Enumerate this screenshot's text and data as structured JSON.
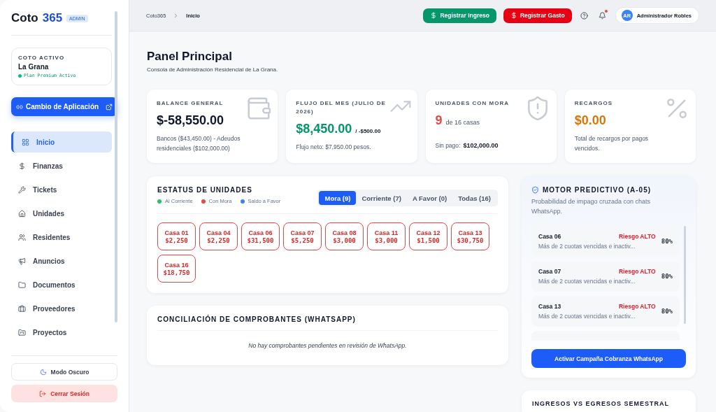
{
  "brand": {
    "name": "Coto",
    "accent": "365",
    "badge": "ADMIN"
  },
  "active_coto": {
    "label": "COTO ACTIVO",
    "name": "La Grana",
    "plan": "Plan Premium Activo"
  },
  "switch_button": "Cambio de Aplicación",
  "sidebar": {
    "items": [
      {
        "label": "Inicio",
        "selected": true
      },
      {
        "label": "Finanzas",
        "selected": false
      },
      {
        "label": "Tickets",
        "selected": false
      },
      {
        "label": "Unidades",
        "selected": false
      },
      {
        "label": "Residentes",
        "selected": false
      },
      {
        "label": "Anuncios",
        "selected": false
      },
      {
        "label": "Documentos",
        "selected": false
      },
      {
        "label": "Proveedores",
        "selected": false
      },
      {
        "label": "Proyectos",
        "selected": false
      }
    ]
  },
  "dark_mode_button": "Modo Oscuro",
  "logout_button": "Cerrar Sesión",
  "breadcrumb": [
    "Coto365",
    "Inicio"
  ],
  "actions": {
    "income": "Registrar Ingreso",
    "expense": "Registrar Gasto"
  },
  "notifications": {
    "unread": true
  },
  "user": {
    "initials": "AR",
    "name": "Administrador Robles"
  },
  "page": {
    "title": "Panel Principal",
    "subtitle": "Consola de Administración Residencial de La Grana."
  },
  "stats": [
    {
      "label": "BALANCE GENERAL",
      "value": "$-58,550.00",
      "note": "Bancos ($43,450.00) - Adeudos residenciales ($102,000.00)"
    },
    {
      "label": "FLUJO DEL MES (JULIO DE 2026)",
      "value": "$8,450.00",
      "extra": "/ -$500.00",
      "note": "Flujo neto: $7,950.00 pesos."
    },
    {
      "label": "UNIDADES CON MORA",
      "value": "9",
      "extra": "de 16 casas",
      "note_label": "Sin pago:",
      "note": "$102,000.00"
    },
    {
      "label": "RECARGOS",
      "value": "$0.00",
      "note": "Total de recargos por pagos vencidos."
    }
  ],
  "units": {
    "title": "ESTATUS DE UNIDADES",
    "legend": [
      {
        "label": "Al Corriente",
        "color": "#22c55e"
      },
      {
        "label": "Con Mora",
        "color": "#ef4444"
      },
      {
        "label": "Saldo a Favor",
        "color": "#3b82f6"
      }
    ],
    "tabs": [
      {
        "label": "Mora (9)",
        "selected": true
      },
      {
        "label": "Corriente (7)",
        "selected": false
      },
      {
        "label": "A Favor (0)",
        "selected": false
      },
      {
        "label": "Todas (16)",
        "selected": false
      }
    ],
    "houses": [
      {
        "name": "Casa 01",
        "amount": "$2,250"
      },
      {
        "name": "Casa 04",
        "amount": "$2,250"
      },
      {
        "name": "Casa 06",
        "amount": "$31,500"
      },
      {
        "name": "Casa 07",
        "amount": "$5,250"
      },
      {
        "name": "Casa 08",
        "amount": "$3,000"
      },
      {
        "name": "Casa 11",
        "amount": "$3,000"
      },
      {
        "name": "Casa 12",
        "amount": "$1,500"
      },
      {
        "name": "Casa 13",
        "amount": "$30,750"
      },
      {
        "name": "Casa 16",
        "amount": "$18,750"
      }
    ]
  },
  "reconciliation": {
    "title": "CONCILIACIÓN DE COMPROBANTES (WHATSAPP)",
    "empty": "No hay comprobantes pendientes en revisión de WhatsApp."
  },
  "predictive": {
    "title": "MOTOR PREDICTIVO (A-05)",
    "subtitle": "Probabilidad de impago cruzada con chats WhatsApp.",
    "rows": [
      {
        "house": "Casa 06",
        "risk": "Riesgo ALTO",
        "detail": "Más de 2 cuotas vencidas e inactiv...",
        "percent": "80%"
      },
      {
        "house": "Casa 07",
        "risk": "Riesgo ALTO",
        "detail": "Más de 2 cuotas vencidas e inactiv...",
        "percent": "80%"
      },
      {
        "house": "Casa 13",
        "risk": "Riesgo ALTO",
        "detail": "Más de 2 cuotas vencidas e inactiv...",
        "percent": "80%"
      }
    ],
    "button": "Activar Campaña Cobranza WhatsApp"
  },
  "chart_card": {
    "title": "INGRESOS VS EGRESOS SEMESTRAL"
  }
}
